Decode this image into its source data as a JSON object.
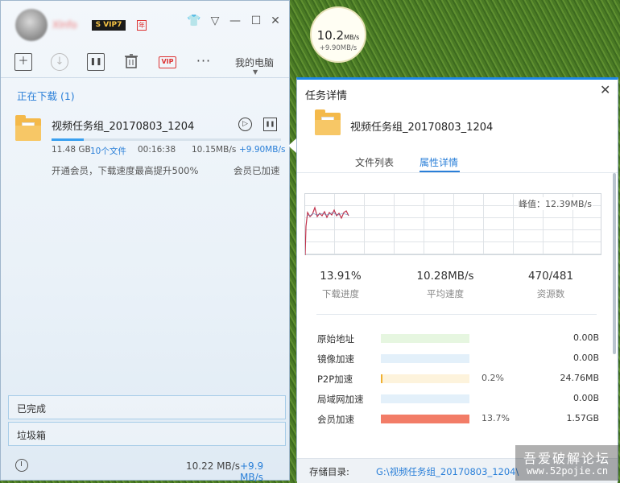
{
  "main": {
    "toolbar": {
      "new_icon": "plus-box-icon",
      "start_icon": "download-circle-icon",
      "pause_icon": "pause-box-icon",
      "delete_icon": "trash-icon",
      "vip_label": "VIP",
      "more_icon": "more-dots-icon",
      "my_pc_label": "我的电脑"
    },
    "badges": {
      "svip": "S VIP7",
      "year": "年"
    },
    "section_downloading": "正在下载 (1)",
    "download": {
      "name": "视频任务组_20170803_1204",
      "size": "11.48 GB",
      "files": "10个文件",
      "time": "00:16:38",
      "speed": "10.15MB/s",
      "upload": "+9.90MB/s",
      "progress": 0.139,
      "promo": "开通会员，下载速度最高提升500%",
      "member_status": "会员已加速"
    },
    "section_completed": "已完成",
    "section_trash": "垃圾箱",
    "footer": {
      "speed": "10.22 MB/s",
      "upload": "+9.9 MB/s"
    }
  },
  "bubble": {
    "speed": "10.2",
    "unit": "MB/s",
    "upload": "+9.90MB/s"
  },
  "detail": {
    "title": "任务详情",
    "name": "视频任务组_20170803_1204",
    "tabs": [
      "文件列表",
      "属性详情"
    ],
    "active_tab": "属性详情",
    "peak": "峰值：12.39MB/s",
    "stats": [
      {
        "value": "13.91%",
        "label": "下载进度"
      },
      {
        "value": "10.28MB/s",
        "label": "平均速度"
      },
      {
        "value": "470/481",
        "label": "资源数"
      }
    ],
    "sources": [
      {
        "label": "原始地址",
        "pct": "",
        "amount": "0.00B",
        "ratio": 1.0,
        "color": "#e6f6e0"
      },
      {
        "label": "镜像加速",
        "pct": "",
        "amount": "0.00B",
        "ratio": 1.0,
        "color": "#e3f0fa"
      },
      {
        "label": "P2P加速",
        "pct": "0.2%",
        "amount": "24.76MB",
        "ratio": 1.0,
        "color": "#fdf3dc"
      },
      {
        "label": "局域网加速",
        "pct": "",
        "amount": "0.00B",
        "ratio": 1.0,
        "color": "#e3f0fa"
      },
      {
        "label": "会员加速",
        "pct": "13.7%",
        "amount": "1.57GB",
        "ratio": 1.0,
        "color": "#f27c67"
      }
    ],
    "p2p_accent": "#f0b030",
    "store_label": "存储目录:",
    "store_path": "G:\\视频任务组_20170803_1204\\"
  },
  "watermark": {
    "line1": "吾爱破解论坛",
    "line2": "www.52pojie.cn"
  },
  "colors": {
    "accent": "#2a7fd8",
    "progress": "#3aa0f0"
  }
}
